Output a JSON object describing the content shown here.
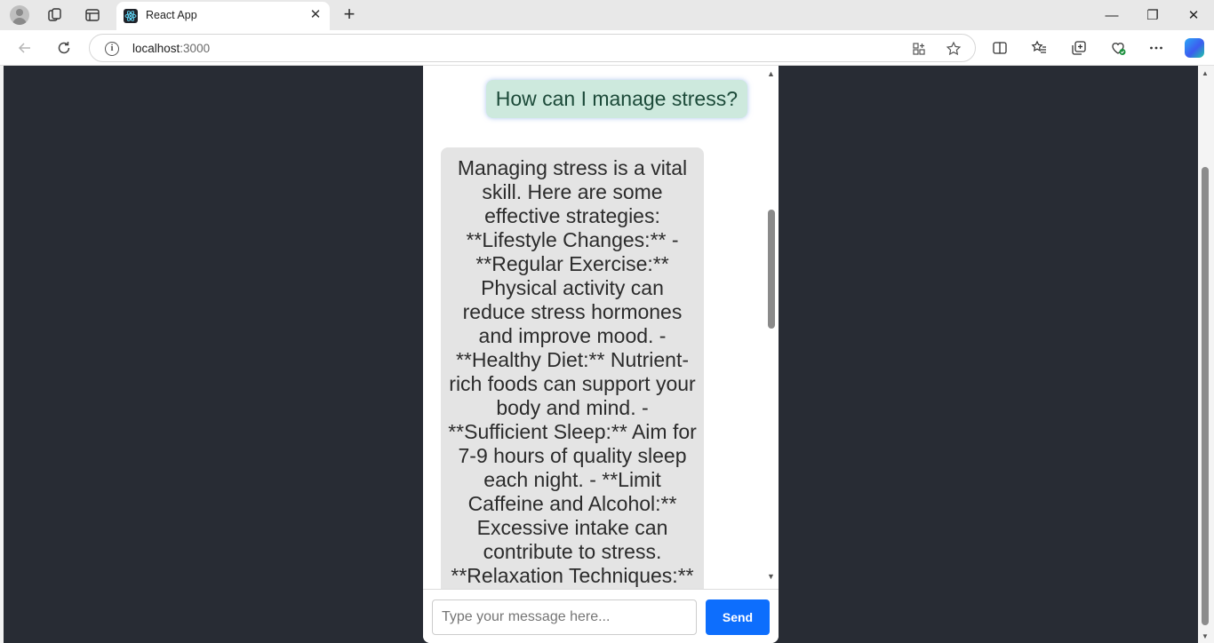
{
  "browser": {
    "tab": {
      "title": "React App",
      "favicon": "react-logo-icon"
    },
    "address": {
      "host": "localhost",
      "port": ":3000"
    },
    "icons": {
      "profile": "profile-icon",
      "workspaces": "workspaces-icon",
      "tab_actions": "vertical-tabs-icon",
      "new_tab": "+",
      "close_tab": "✕",
      "minimize": "—",
      "restore": "❐",
      "close_window": "✕"
    }
  },
  "chat": {
    "user_message": "How can I manage stress?",
    "bot_message": "Managing stress is a vital skill. Here are some effective strategies: **Lifestyle Changes:** - **Regular Exercise:** Physical activity can reduce stress hormones and improve mood. - **Healthy Diet:** Nutrient-rich foods can support your body and mind. - **Sufficient Sleep:** Aim for 7-9 hours of quality sleep each night. - **Limit Caffeine and Alcohol:** Excessive intake can contribute to stress. **Relaxation Techniques:**",
    "input_placeholder": "Type your message here...",
    "send_label": "Send"
  },
  "colors": {
    "page_background": "#282c34",
    "user_bubble": "#cde9dd",
    "bot_bubble": "#e4e4e4",
    "send_button": "#0d6efd"
  }
}
